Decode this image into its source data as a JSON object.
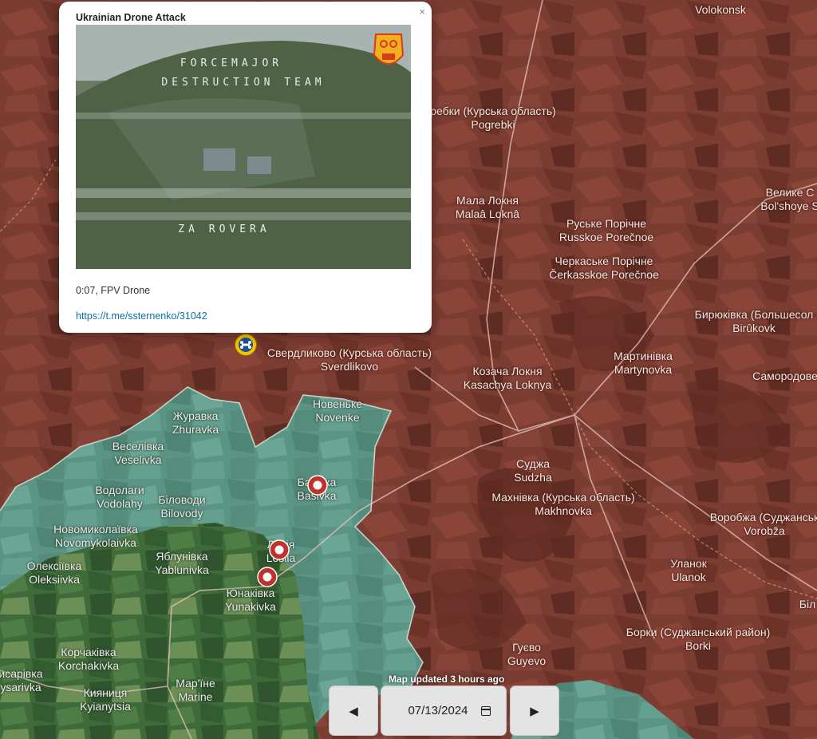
{
  "popup": {
    "title": "Ukrainian Drone Attack",
    "close": "×",
    "overlay_line1": "FORCEMAJOR",
    "overlay_line2": "DESTRUCTION TEAM",
    "overlay_line3": "ZA ROVERA",
    "caption": "0:07, FPV Drone",
    "link": "https://t.me/ssternenko/31042"
  },
  "places": [
    {
      "l1": "Volokonsk",
      "l2": ""
    },
    {
      "l1": "ребки (Курська область)",
      "l2": "Pogrebki"
    },
    {
      "l1": "Мала Локня",
      "l2": "Malaâ Loknâ"
    },
    {
      "l1": "Велике С",
      "l2": "Bol'shoye S"
    },
    {
      "l1": "Руське Порічне",
      "l2": "Russkoe Porečnoe"
    },
    {
      "l1": "Черкаське Порічне",
      "l2": "Čerkasskoe Porečnoe"
    },
    {
      "l1": "Бирюківка (Большесол",
      "l2": "Birûkovk"
    },
    {
      "l1": "Свердликово (Курська область)",
      "l2": "Sverdlikovo"
    },
    {
      "l1": "Мартинівка",
      "l2": "Martynovka"
    },
    {
      "l1": "Самородове",
      "l2": ""
    },
    {
      "l1": "Козача Локня",
      "l2": "Kasachya Loknya"
    },
    {
      "l1": "Новеньке",
      "l2": "Novenke"
    },
    {
      "l1": "Журавка",
      "l2": "Zhuravka"
    },
    {
      "l1": "Веселівка",
      "l2": "Veselivka"
    },
    {
      "l1": "Суджа",
      "l2": "Sudzha"
    },
    {
      "l1": "Басівка",
      "l2": "Basivka"
    },
    {
      "l1": "Водолаги",
      "l2": "Vodolahy"
    },
    {
      "l1": "Білов­оди",
      "l2": "Bilovody"
    },
    {
      "l1": "Махнівка (Курська область)",
      "l2": "Makhnovka"
    },
    {
      "l1": "Воробжа (Суджанськ",
      "l2": "Vorobža"
    },
    {
      "l1": "Новомиколаївка",
      "l2": "Novomykolaivka"
    },
    {
      "l1": "Яблунівка",
      "l2": "Yablunivka"
    },
    {
      "l1": "Лосія",
      "l2": "Losiia"
    },
    {
      "l1": "Олексіївка",
      "l2": "Oleksiivka"
    },
    {
      "l1": "Уланок",
      "l2": "Ulanok"
    },
    {
      "l1": "Юнаківка",
      "l2": "Yunakivka"
    },
    {
      "l1": "Біл",
      "l2": ""
    },
    {
      "l1": "Борки (Суджанський район)",
      "l2": "Borki"
    },
    {
      "l1": "Гуєво",
      "l2": "Guyevo"
    },
    {
      "l1": "Корчаківка",
      "l2": "Korchakivka"
    },
    {
      "l1": "исарівка",
      "l2": "ysarivka"
    },
    {
      "l1": "Кияниця",
      "l2": "Kyianytsia"
    },
    {
      "l1": "Мар'їне",
      "l2": "Marine"
    }
  ],
  "markers": [
    {
      "type": "drone-attack",
      "icon": "drone-icon",
      "color": "#f2c400"
    },
    {
      "type": "combat",
      "icon": "explosion-icon",
      "color": "#c0322c"
    },
    {
      "type": "combat",
      "icon": "explosion-icon",
      "color": "#c0322c"
    },
    {
      "type": "combat",
      "icon": "explosion-icon",
      "color": "#c0322c"
    }
  ],
  "controls": {
    "updated": "Map updated 3 hours ago",
    "prev": "◀",
    "date": "07/13/2024",
    "next": "▶"
  },
  "colors": {
    "russia_held": "#7a3b30",
    "ukraine_held": "#5d9585"
  }
}
